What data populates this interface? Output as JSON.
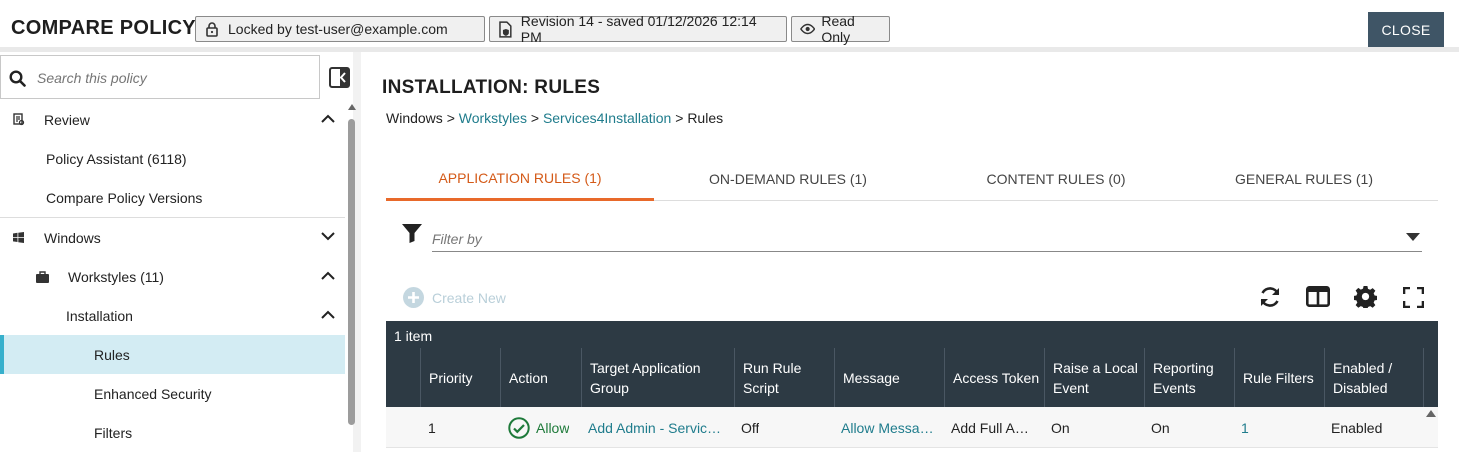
{
  "header": {
    "title": "COMPARE POLICY",
    "lock_label": "Locked by test-user@example.com",
    "revision_label": "Revision 14 - saved 01/12/2026 12:14 PM",
    "readonly_label": "Read Only",
    "close_label": "CLOSE"
  },
  "sidebar": {
    "search_placeholder": "Search this policy",
    "items": [
      {
        "label": "Review",
        "icon": "review-icon"
      },
      {
        "label": "Policy Assistant (6118)"
      },
      {
        "label": "Compare Policy Versions"
      },
      {
        "label": "Windows",
        "icon": "windows-icon"
      },
      {
        "label": "Workstyles (11)",
        "icon": "briefcase-icon"
      },
      {
        "label": "Installation"
      },
      {
        "label": "Rules"
      },
      {
        "label": "Enhanced Security"
      },
      {
        "label": "Filters"
      }
    ]
  },
  "main": {
    "title": "INSTALLATION: RULES",
    "breadcrumb": {
      "root": "Windows",
      "sep": ">",
      "workstyles": "Workstyles",
      "workstyle": "Services4Installation",
      "current": "Rules"
    },
    "tabs": [
      {
        "label": "APPLICATION RULES (1)",
        "active": true
      },
      {
        "label": "ON-DEMAND RULES (1)"
      },
      {
        "label": "CONTENT RULES (0)"
      },
      {
        "label": "GENERAL RULES (1)"
      }
    ],
    "filter_placeholder": "Filter by",
    "create_new_label": "Create New",
    "grid": {
      "count_label": "1 item",
      "columns": [
        "Priority",
        "Action",
        "Target Application Group",
        "Run Rule Script",
        "Message",
        "Access Token",
        "Raise a Local Event",
        "Reporting Events",
        "Rule Filters",
        "Enabled / Disabled"
      ],
      "rows": [
        {
          "priority": "1",
          "action": "Allow",
          "target_group": "Add Admin - Servic…",
          "run_rule_script": "Off",
          "message": "Allow Messa…",
          "access_token": "Add Full A…",
          "raise_local_event": "On",
          "reporting_events": "On",
          "rule_filters": "1",
          "enabled": "Enabled"
        }
      ]
    }
  },
  "colors": {
    "accent_tab": "#e8692a",
    "link": "#1f7c8c",
    "grid_header": "#2d3a44",
    "close_button": "#3f5566",
    "active_nav": "#d3ecf3",
    "allow_green": "#1e7a3a"
  }
}
